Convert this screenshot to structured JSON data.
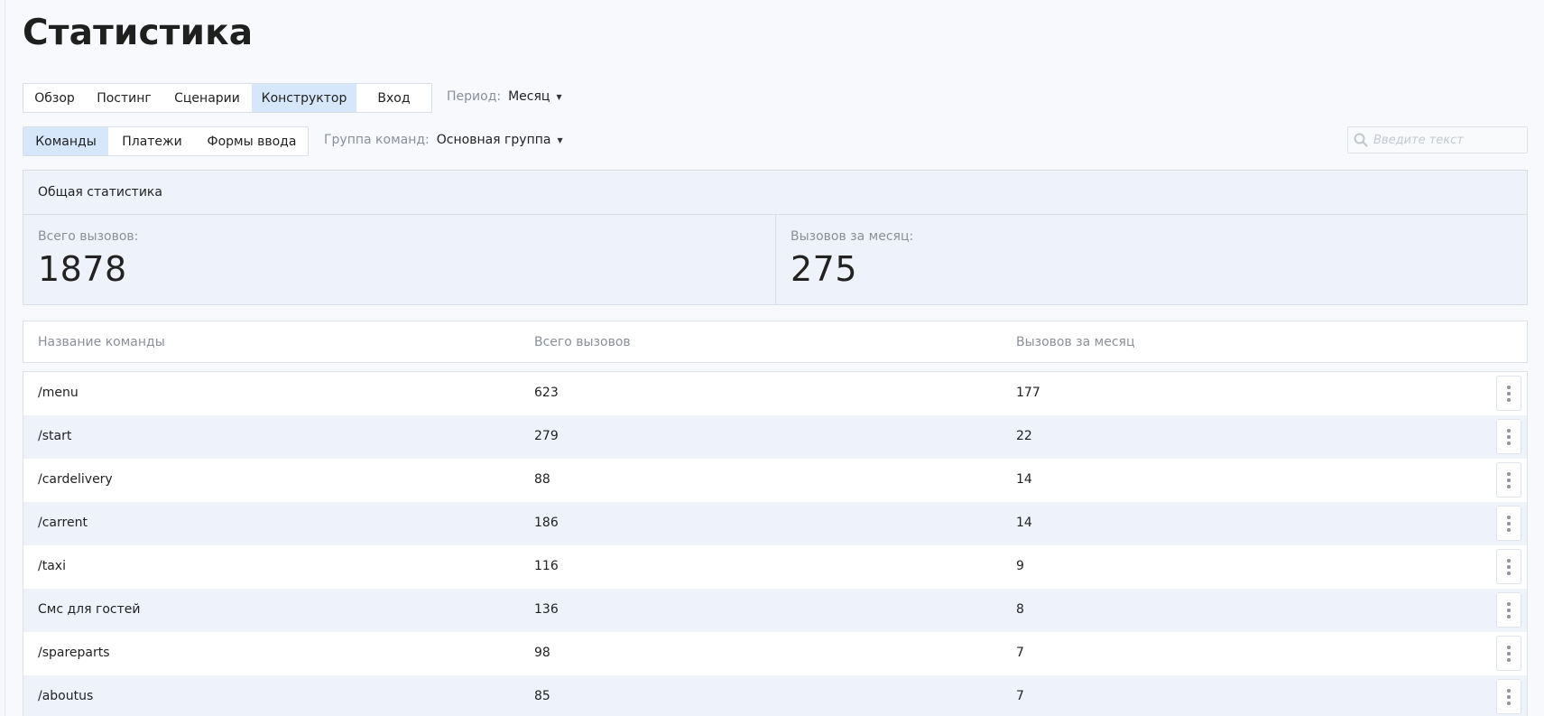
{
  "page_title": "Статистика",
  "tabs_primary": [
    {
      "label": "Обзор",
      "active": false
    },
    {
      "label": "Постинг",
      "active": false
    },
    {
      "label": "Сценарии",
      "active": false
    },
    {
      "label": "Конструктор",
      "active": true
    },
    {
      "label": "Вход",
      "active": false
    }
  ],
  "period_filter": {
    "label": "Период:",
    "value": "Месяц"
  },
  "tabs_secondary": [
    {
      "label": "Команды",
      "active": true
    },
    {
      "label": "Платежи",
      "active": false
    },
    {
      "label": "Формы ввода",
      "active": false
    }
  ],
  "group_filter": {
    "label": "Группа команд:",
    "value": "Основная группа"
  },
  "search": {
    "placeholder": "Введите текст",
    "value": ""
  },
  "summary": {
    "heading": "Общая статистика",
    "total_label": "Всего вызовов:",
    "total_value": "1878",
    "month_label": "Вызовов за месяц:",
    "month_value": "275"
  },
  "table": {
    "columns": [
      "Название команды",
      "Всего вызовов",
      "Вызовов за месяц"
    ],
    "rows": [
      {
        "name": "/menu",
        "total": "623",
        "month": "177"
      },
      {
        "name": "/start",
        "total": "279",
        "month": "22"
      },
      {
        "name": "/cardelivery",
        "total": "88",
        "month": "14"
      },
      {
        "name": "/carrent",
        "total": "186",
        "month": "14"
      },
      {
        "name": "/taxi",
        "total": "116",
        "month": "9"
      },
      {
        "name": "Смс для гостей",
        "total": "136",
        "month": "8"
      },
      {
        "name": "/spareparts",
        "total": "98",
        "month": "7"
      },
      {
        "name": "/aboutus",
        "total": "85",
        "month": "7"
      }
    ]
  },
  "colors": {
    "accent": "#d6e6fb",
    "row_alt": "#eef3fb",
    "muted_text": "#8a8f99"
  }
}
